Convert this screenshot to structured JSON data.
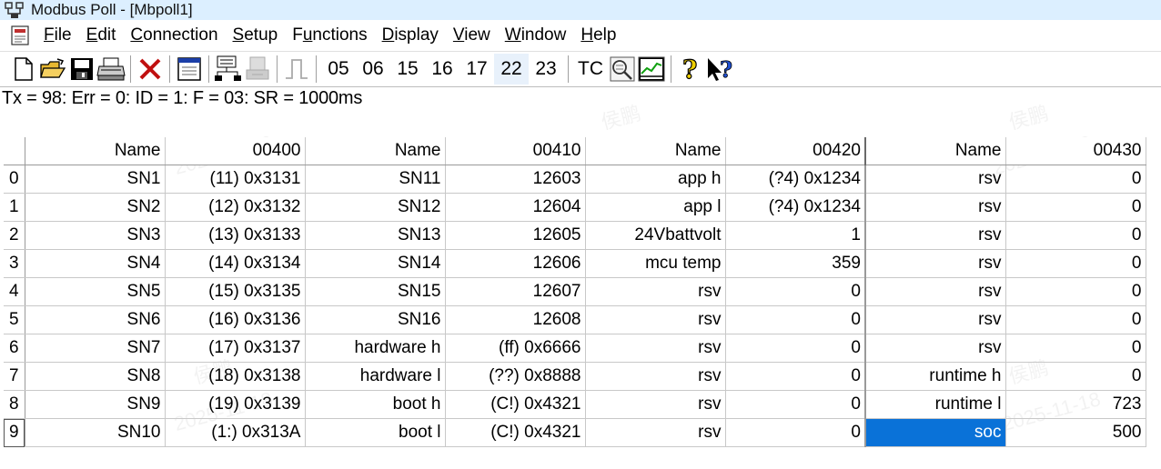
{
  "window": {
    "title": "Modbus Poll - [Mbpoll1]"
  },
  "menu": [
    {
      "pre": "",
      "u": "F",
      "post": "ile"
    },
    {
      "pre": "",
      "u": "E",
      "post": "dit"
    },
    {
      "pre": "",
      "u": "C",
      "post": "onnection"
    },
    {
      "pre": "",
      "u": "S",
      "post": "etup"
    },
    {
      "pre": "F",
      "u": "u",
      "post": "nctions"
    },
    {
      "pre": "",
      "u": "D",
      "post": "isplay"
    },
    {
      "pre": "",
      "u": "V",
      "post": "iew"
    },
    {
      "pre": "",
      "u": "W",
      "post": "indow"
    },
    {
      "pre": "",
      "u": "H",
      "post": "elp"
    }
  ],
  "toolbar": {
    "icons": [
      "new-document-icon",
      "open-folder-icon",
      "save-icon",
      "print-icon",
      "close-x-icon",
      "window-icon",
      "connect-icon",
      "disconnect-icon",
      "single-poll-icon"
    ],
    "function_labels": [
      "05",
      "06",
      "15",
      "16",
      "17",
      "22",
      "23"
    ],
    "pressed": "22",
    "tc_label": "TC",
    "icons2": [
      "traffic-monitor-icon",
      "realtime-chart-icon",
      "help-icon",
      "context-help-icon"
    ]
  },
  "status_line": "Tx = 98: Err = 0: ID = 1: F = 03: SR = 1000ms",
  "table": {
    "columns": [
      "Name",
      "00400",
      "Name",
      "00410",
      "Name",
      "00420",
      "Name",
      "00430"
    ],
    "rows": [
      {
        "idx": "0",
        "cells": [
          "SN1",
          "(11) 0x3131",
          "SN11",
          "12603",
          "app  h",
          "(?4) 0x1234",
          "rsv",
          "0"
        ]
      },
      {
        "idx": "1",
        "cells": [
          "SN2",
          "(12) 0x3132",
          "SN12",
          "12604",
          "app  l",
          "(?4) 0x1234",
          "rsv",
          "0"
        ]
      },
      {
        "idx": "2",
        "cells": [
          "SN3",
          "(13) 0x3133",
          "SN13",
          "12605",
          "24Vbattvolt",
          "1",
          "rsv",
          "0"
        ]
      },
      {
        "idx": "3",
        "cells": [
          "SN4",
          "(14) 0x3134",
          "SN14",
          "12606",
          "mcu  temp",
          "359",
          "rsv",
          "0"
        ]
      },
      {
        "idx": "4",
        "cells": [
          "SN5",
          "(15) 0x3135",
          "SN15",
          "12607",
          "rsv",
          "0",
          "rsv",
          "0"
        ]
      },
      {
        "idx": "5",
        "cells": [
          "SN6",
          "(16) 0x3136",
          "SN16",
          "12608",
          "rsv",
          "0",
          "rsv",
          "0"
        ]
      },
      {
        "idx": "6",
        "cells": [
          "SN7",
          "(17) 0x3137",
          "hardware  h",
          "(ff) 0x6666",
          "rsv",
          "0",
          "rsv",
          "0"
        ]
      },
      {
        "idx": "7",
        "cells": [
          "SN8",
          "(18) 0x3138",
          "hardware  l",
          "(??) 0x8888",
          "rsv",
          "0",
          "runtime  h",
          "0"
        ]
      },
      {
        "idx": "8",
        "cells": [
          "SN9",
          "(19) 0x3139",
          "boot  h",
          "(C!) 0x4321",
          "rsv",
          "0",
          "runtime  l",
          "723"
        ]
      },
      {
        "idx": "9",
        "cells": [
          "SN10",
          "(1:) 0x313A",
          "boot  l",
          "(C!) 0x4321",
          "rsv",
          "0",
          "soc",
          "500"
        ]
      }
    ],
    "selected": {
      "row": 9,
      "col": 6
    }
  },
  "watermark": {
    "name": "侯鹏",
    "date": "2025-11-18"
  }
}
